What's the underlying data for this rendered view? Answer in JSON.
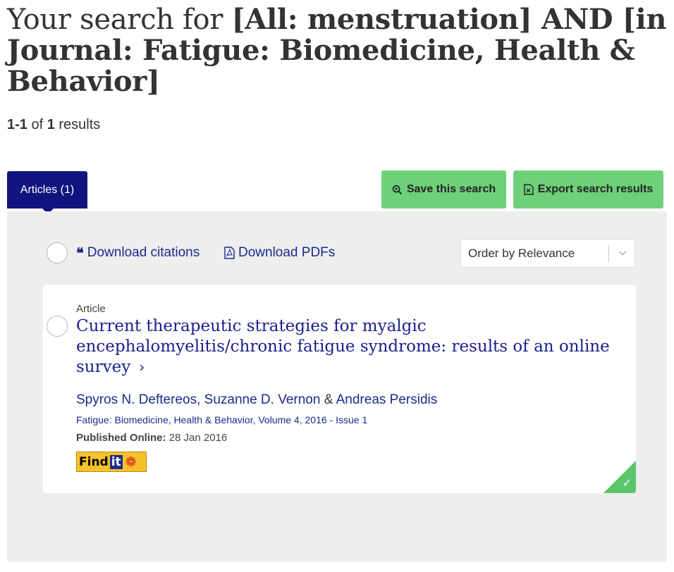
{
  "heading": {
    "prefix": "Your search for ",
    "query": "[All: menstruation] AND [in Journal: Fatigue: Biomedicine, Health & Behavior]"
  },
  "result_count": {
    "range": "1-1",
    "of": " of ",
    "total": "1",
    "suffix": " results"
  },
  "tabs": [
    {
      "label": "Articles (1)",
      "active": true
    }
  ],
  "actions": {
    "save_label": "Save this search",
    "save_icon": "search-icon",
    "export_label": "Export search results",
    "export_icon": "excel-file-icon"
  },
  "toolbar": {
    "download_citations": "Download citations",
    "download_citations_icon": "quote-icon",
    "download_pdfs": "Download PDFs",
    "download_pdfs_icon": "pdf-file-icon",
    "order_by": "Order by Relevance"
  },
  "results": [
    {
      "type": "Article",
      "title": "Current therapeutic strategies for myalgic encephalomyelitis/chronic fatigue syndrome: results of an online survey",
      "authors": [
        "Spyros N. Deftereos",
        "Suzanne D. Vernon",
        "Andreas Persidis"
      ],
      "author_sep": ", ",
      "author_amp": " & ",
      "journal": "Fatigue: Biomedicine, Health & Behavior, Volume 4, 2016 - Issue 1",
      "published_label": "Published Online:",
      "published_date": " 28 Jan 2016",
      "findit_label": "Find",
      "findit_it": "it",
      "access_badge": "check-icon"
    }
  ],
  "colors": {
    "tab_bg": "#10147e",
    "button_green": "#6fd07a",
    "link_blue": "#1a2b8c",
    "title_blue": "#1a1f8c",
    "panel_bg": "#eeeeee",
    "access_green": "#5cc56b"
  }
}
